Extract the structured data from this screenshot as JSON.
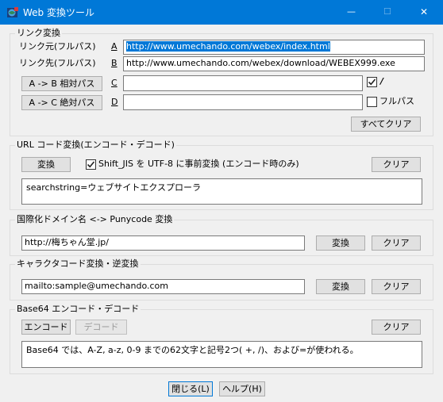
{
  "window": {
    "title": "Web 変換ツール",
    "minimize_glyph": "—",
    "maximize_glyph": "☐",
    "close_glyph": "✕"
  },
  "link": {
    "legend": "リンク変換",
    "source_label": "リンク元(フルパス)",
    "source_key": "A",
    "source_value": "http://www.umechando.com/webex/index.html",
    "target_label": "リンク先(フルパス)",
    "target_key": "B",
    "target_value": "http://www.umechando.com/webex/download/WEBEX999.exe",
    "relative_button": "A -> B 相対パス",
    "relative_key": "C",
    "relative_value": "",
    "relative_checkbox_glyph": "/",
    "absolute_button": "A -> C 絶対パス",
    "absolute_key": "D",
    "absolute_value": "",
    "fullpath_checkbox_label": "フルパス",
    "clear_all_button": "すべてクリア"
  },
  "url": {
    "legend": "URL コード変換(エンコード・デコード)",
    "convert_button": "変換",
    "checkbox_label": "Shift_JIS を UTF-8 に事前変換 (エンコード時のみ)",
    "clear_button": "クリア",
    "text_value": "searchstring=ウェブサイトエクスプローラ"
  },
  "idn": {
    "legend": "国際化ドメイン名 <-> Punycode 変換",
    "input_value": "http://梅ちゃん堂.jp/",
    "convert_button": "変換",
    "clear_button": "クリア"
  },
  "charcode": {
    "legend": "キャラクタコード変換・逆変換",
    "input_value": "mailto:sample@umechando.com",
    "convert_button": "変換",
    "clear_button": "クリア"
  },
  "base64": {
    "legend": "Base64 エンコード・デコード",
    "encode_button": "エンコード",
    "decode_button": "デコード",
    "clear_button": "クリア",
    "text_value": "Base64 では、A-Z, a-z, 0-9 までの62文字と記号2つ( +, /)、および=が使われる。"
  },
  "footer": {
    "close_button": "閉じる(L)",
    "help_button": "ヘルプ(H)"
  },
  "colors": {
    "titlebar": "#0078d7",
    "window_bg": "#f0f0f0",
    "selection": "#0078d7"
  },
  "icons": {
    "app": "app-globe-icon",
    "check": "checkmark-icon"
  }
}
